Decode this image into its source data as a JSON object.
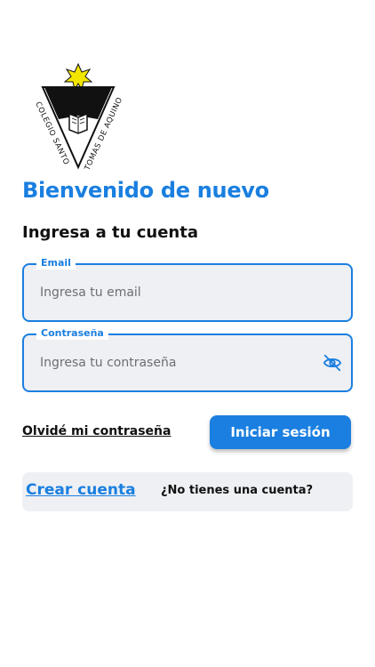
{
  "logo": {
    "text": "COLEGIO SANTO TOMAS DE AQUINO",
    "star_color": "#f2e600"
  },
  "header": {
    "title": "Bienvenido de nuevo",
    "subtitle": "Ingresa a tu cuenta"
  },
  "form": {
    "email": {
      "label": "Email",
      "placeholder": "Ingresa tu email",
      "value": ""
    },
    "password": {
      "label": "Contraseña",
      "placeholder": "Ingresa tu contraseña",
      "value": "",
      "toggle_icon": "eye-off-icon"
    }
  },
  "actions": {
    "forgot_label": "Olvidé mi contraseña",
    "login_label": "Iniciar sesión"
  },
  "signup": {
    "create_label": "Crear cuenta",
    "prompt": "¿No tienes una cuenta?"
  },
  "colors": {
    "accent": "#1a7fe0",
    "field_bg": "#eef0f4"
  }
}
